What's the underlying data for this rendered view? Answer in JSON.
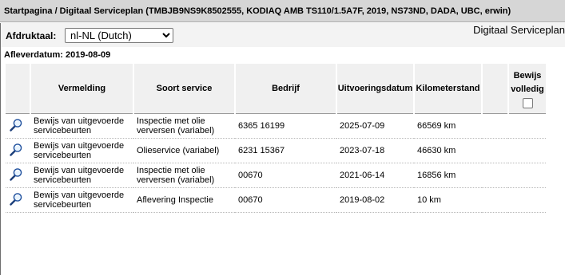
{
  "breadcrumb": "Startpagina / Digitaal Serviceplan (TMBJB9NS9K8502555, KODIAQ AMB TS110/1.5A7F, 2019, NS73ND, DADA, UBC, erwin)",
  "toolbar": {
    "print_label": "Afdruktaal:",
    "print_language": "nl-NL (Dutch)",
    "page_heading": "Digitaal Serviceplan"
  },
  "delivery_date": "Afleverdatum: 2019-08-09",
  "table": {
    "headers": {
      "vermelding": "Vermelding",
      "soort_service": "Soort service",
      "bedrijf": "Bedrijf",
      "uitvoeringsdatum": "Uitvoeringsdatum",
      "kilometerstand": "Kilometerstand",
      "bewijs_line1": "Bewijs",
      "bewijs_line2": "volledig"
    },
    "rows": [
      {
        "vermelding": "Bewijs van uitgevoerde servicebeurten",
        "soort": "Inspectie met olie verversen (variabel)",
        "bedrijf": "6365 16199",
        "datum": "2025-07-09",
        "km": "66569 km"
      },
      {
        "vermelding": "Bewijs van uitgevoerde servicebeurten",
        "soort": "Olieservice (variabel)",
        "bedrijf": "6231 15367",
        "datum": "2023-07-18",
        "km": "46630 km"
      },
      {
        "vermelding": "Bewijs van uitgevoerde servicebeurten",
        "soort": "Inspectie met olie verversen (variabel)",
        "bedrijf": "00670",
        "datum": "2021-06-14",
        "km": "16856 km"
      },
      {
        "vermelding": "Bewijs van uitgevoerde servicebeurten",
        "soort": "Aflevering Inspectie",
        "bedrijf": "00670",
        "datum": "2019-08-02",
        "km": "10 km"
      }
    ]
  },
  "icons": {
    "row_view": "magnifier-icon"
  }
}
